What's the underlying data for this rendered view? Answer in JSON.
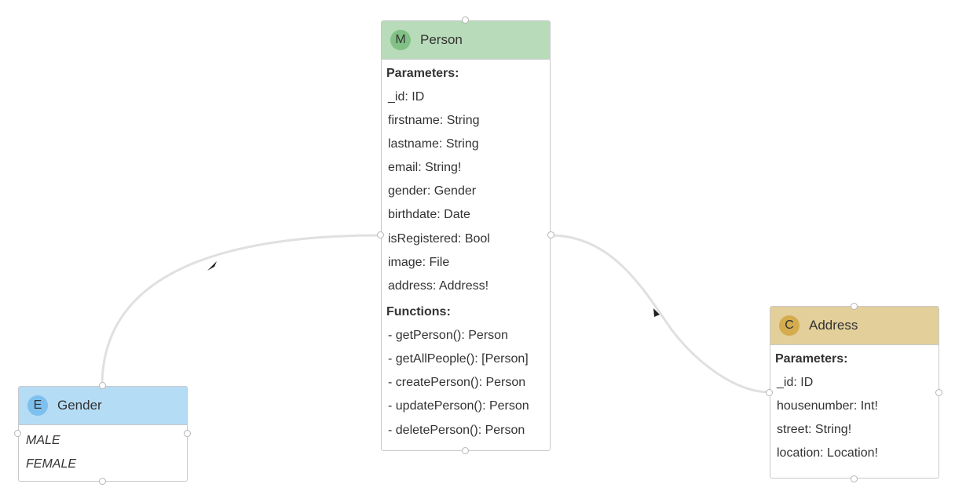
{
  "colors": {
    "model_header": "#b8dbb9",
    "model_badge": "#82c185",
    "class_header": "#e3cf9a",
    "class_badge": "#d4ac4d",
    "enum_header": "#b5dcf5",
    "enum_badge": "#7dc0ee",
    "edge": "#e0e0e0",
    "arrow": "#222222"
  },
  "nodes": {
    "person": {
      "badge": "M",
      "title": "Person",
      "params_title": "Parameters:",
      "params": [
        "_id: ID",
        "firstname: String",
        "lastname: String",
        "email: String!",
        "gender: Gender",
        "birthdate: Date",
        "isRegistered: Bool",
        "image: File",
        "address: Address!"
      ],
      "functions_title": "Functions:",
      "functions": [
        "- getPerson(): Person",
        "- getAllPeople(): [Person]",
        "- createPerson(): Person",
        "- updatePerson(): Person",
        "- deletePerson(): Person"
      ]
    },
    "address": {
      "badge": "C",
      "title": "Address",
      "params_title": "Parameters:",
      "params": [
        "_id: ID",
        "housenumber: Int!",
        "street: String!",
        "location: Location!"
      ]
    },
    "gender": {
      "badge": "E",
      "title": "Gender",
      "values": [
        "MALE",
        "FEMALE"
      ]
    }
  }
}
